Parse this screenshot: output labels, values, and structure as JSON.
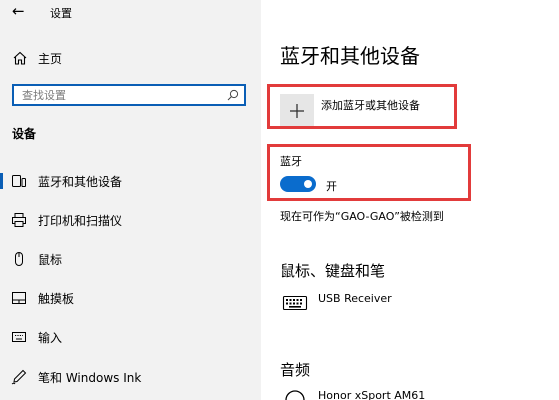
{
  "titlebar": {
    "back_glyph": "←",
    "title": "设置"
  },
  "sidebar": {
    "home_label": "主页",
    "search_placeholder": "查找设置",
    "section_title": "设备",
    "items": [
      {
        "label": "蓝牙和其他设备",
        "icon": "bluetooth-devices-icon",
        "selected": true
      },
      {
        "label": "打印机和扫描仪",
        "icon": "printer-icon",
        "selected": false
      },
      {
        "label": "鼠标",
        "icon": "mouse-icon",
        "selected": false
      },
      {
        "label": "触摸板",
        "icon": "touchpad-icon",
        "selected": false
      },
      {
        "label": "输入",
        "icon": "keyboard-input-icon",
        "selected": false
      },
      {
        "label": "笔和 Windows Ink",
        "icon": "pen-icon",
        "selected": false
      }
    ]
  },
  "main": {
    "title": "蓝牙和其他设备",
    "add_device_label": "添加蓝牙或其他设备",
    "bluetooth_label": "蓝牙",
    "bluetooth_state": "开",
    "bluetooth_on": true,
    "discoverable_text": "现在可作为“GAO-GAO”被检测到",
    "groups": [
      {
        "title": "鼠标、键盘和笔",
        "devices": [
          {
            "name": "USB Receiver",
            "icon": "keyboard-icon"
          }
        ]
      },
      {
        "title": "音频",
        "devices": [
          {
            "name": "Honor xSport AM61",
            "icon": "headphones-icon"
          }
        ]
      }
    ]
  },
  "colors": {
    "accent": "#0a6ccd",
    "highlight_box": "#e23b3b",
    "sidebar_bg": "#f2f2f2"
  }
}
